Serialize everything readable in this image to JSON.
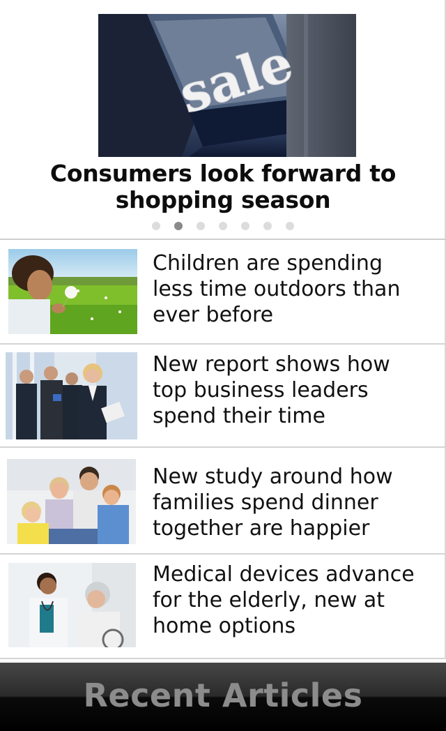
{
  "featured": {
    "image_sign_text": "sale",
    "title_line1": "Consumers look forward to",
    "title_line2": "shopping season",
    "carousel_total": 7,
    "carousel_active_index": 1
  },
  "articles": [
    {
      "lines": [
        "Children are spending",
        "less time outdoors than",
        "ever before"
      ]
    },
    {
      "lines": [
        "New report shows how",
        "top business leaders",
        "spend their time"
      ]
    },
    {
      "lines": [
        "New study around how",
        "families spend dinner",
        "together are happier"
      ]
    },
    {
      "lines": [
        "Medical devices advance",
        "for the elderly, new at",
        "home options"
      ]
    }
  ],
  "bottom_nav": {
    "label": "Recent Articles"
  }
}
